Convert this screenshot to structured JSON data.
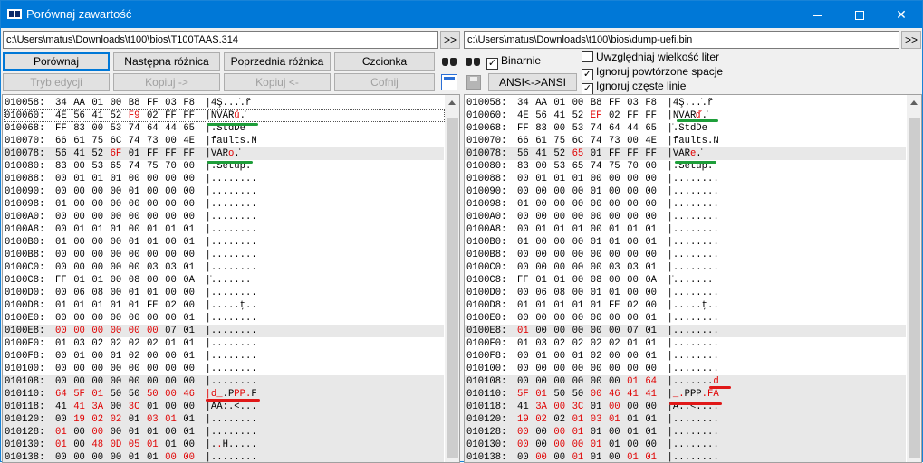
{
  "window": {
    "title": "Porównaj zawartość"
  },
  "left": {
    "path": "c:\\Users\\matus\\Downloads\\t100\\bios\\T100TAAS.314",
    "browse_label": ">>"
  },
  "right": {
    "path": "c:\\Users\\matus\\Downloads\\t100\\bios\\dump-uefi.bin",
    "browse_label": ">>"
  },
  "toolbar": {
    "compare": "Porównaj",
    "next_diff": "Następna różnica",
    "prev_diff": "Poprzednia różnica",
    "font": "Czcionka",
    "edit_mode": "Tryb edycji",
    "copy_right": "Kopiuj ->",
    "copy_left": "Kopiuj <-",
    "undo": "Cofnij",
    "ansi": "ANSI<->ANSI",
    "binary": "Binarnie",
    "case_sensitive": "Uwzględniaj wielkość liter",
    "ignore_spaces": "Ignoruj powtórzone spacje",
    "ignore_lines": "Ignoruj częste linie"
  },
  "checks": {
    "binary": true,
    "case_sensitive": false,
    "ignore_spaces": true,
    "ignore_lines": true
  },
  "colors": {
    "titlebar": "#0078d7",
    "diff": "#e00000",
    "alt_row": "#e8e8e8",
    "mark_green": "#1e9e3a",
    "mark_red": "#e01818"
  },
  "left_rows": [
    {
      "a": "010058:",
      "h": [
        "34",
        "AA",
        "01",
        "00",
        "B8",
        "FF",
        "03",
        "F8"
      ],
      "t": "|4Ş...̇.ř",
      "d": []
    },
    {
      "a": "010060:",
      "h": [
        "4E",
        "56",
        "41",
        "52",
        "F9",
        "02",
        "FF",
        "FF"
      ],
      "t": "|NVARů.̇̇",
      "d": [
        4
      ],
      "dt": [
        5
      ]
    },
    {
      "a": "010068:",
      "h": [
        "FF",
        "83",
        "00",
        "53",
        "74",
        "64",
        "44",
        "65"
      ],
      "t": "|̇.StdDe",
      "d": []
    },
    {
      "a": "010070:",
      "h": [
        "66",
        "61",
        "75",
        "6C",
        "74",
        "73",
        "00",
        "4E"
      ],
      "t": "|faults.N",
      "d": []
    },
    {
      "a": "010078:",
      "h": [
        "56",
        "41",
        "52",
        "6F",
        "01",
        "FF",
        "FF",
        "FF"
      ],
      "t": "|VARo.̇̇̇",
      "d": [
        3
      ],
      "dt": [
        4
      ]
    },
    {
      "a": "010080:",
      "h": [
        "83",
        "00",
        "53",
        "65",
        "74",
        "75",
        "70",
        "00"
      ],
      "t": "|.Setup.",
      "d": []
    },
    {
      "a": "010088:",
      "h": [
        "00",
        "01",
        "01",
        "01",
        "00",
        "00",
        "00",
        "00"
      ],
      "t": "|........",
      "d": []
    },
    {
      "a": "010090:",
      "h": [
        "00",
        "00",
        "00",
        "00",
        "01",
        "00",
        "00",
        "00"
      ],
      "t": "|........",
      "d": []
    },
    {
      "a": "010098:",
      "h": [
        "01",
        "00",
        "00",
        "00",
        "00",
        "00",
        "00",
        "00"
      ],
      "t": "|........",
      "d": []
    },
    {
      "a": "0100A0:",
      "h": [
        "00",
        "00",
        "00",
        "00",
        "00",
        "00",
        "00",
        "00"
      ],
      "t": "|........",
      "d": []
    },
    {
      "a": "0100A8:",
      "h": [
        "00",
        "01",
        "01",
        "01",
        "00",
        "01",
        "01",
        "01"
      ],
      "t": "|........",
      "d": []
    },
    {
      "a": "0100B0:",
      "h": [
        "01",
        "00",
        "00",
        "00",
        "01",
        "01",
        "00",
        "01"
      ],
      "t": "|........",
      "d": []
    },
    {
      "a": "0100B8:",
      "h": [
        "00",
        "00",
        "00",
        "00",
        "00",
        "00",
        "00",
        "00"
      ],
      "t": "|........",
      "d": []
    },
    {
      "a": "0100C0:",
      "h": [
        "00",
        "00",
        "00",
        "00",
        "00",
        "03",
        "03",
        "01"
      ],
      "t": "|........",
      "d": []
    },
    {
      "a": "0100C8:",
      "h": [
        "FF",
        "01",
        "01",
        "00",
        "08",
        "00",
        "00",
        "0A"
      ],
      "t": "|̇.......",
      "d": []
    },
    {
      "a": "0100D0:",
      "h": [
        "00",
        "06",
        "08",
        "00",
        "01",
        "01",
        "00",
        "00"
      ],
      "t": "|........",
      "d": []
    },
    {
      "a": "0100D8:",
      "h": [
        "01",
        "01",
        "01",
        "01",
        "01",
        "FE",
        "02",
        "00"
      ],
      "t": "|.....ţ..",
      "d": []
    },
    {
      "a": "0100E0:",
      "h": [
        "00",
        "00",
        "00",
        "00",
        "00",
        "00",
        "00",
        "01"
      ],
      "t": "|........",
      "d": []
    },
    {
      "a": "0100E8:",
      "h": [
        "00",
        "00",
        "00",
        "00",
        "00",
        "00",
        "07",
        "01"
      ],
      "t": "|........",
      "d": [
        0,
        1,
        2,
        3,
        4,
        5
      ]
    },
    {
      "a": "0100F0:",
      "h": [
        "01",
        "03",
        "02",
        "02",
        "02",
        "02",
        "01",
        "01"
      ],
      "t": "|........",
      "d": []
    },
    {
      "a": "0100F8:",
      "h": [
        "00",
        "01",
        "00",
        "01",
        "02",
        "00",
        "00",
        "01"
      ],
      "t": "|........",
      "d": []
    },
    {
      "a": "010100:",
      "h": [
        "00",
        "00",
        "00",
        "00",
        "00",
        "00",
        "00",
        "00"
      ],
      "t": "|........",
      "d": []
    },
    {
      "a": "010108:",
      "h": [
        "00",
        "00",
        "00",
        "00",
        "00",
        "00",
        "00",
        "00"
      ],
      "t": "|........",
      "d": []
    },
    {
      "a": "010110:",
      "h": [
        "64",
        "5F",
        "01",
        "50",
        "50",
        "50",
        "00",
        "46"
      ],
      "t": "|d_.PPP.F",
      "d": [
        0,
        1,
        2,
        5,
        6,
        7
      ],
      "dt": [
        0,
        1,
        2,
        5,
        6,
        7
      ]
    },
    {
      "a": "010118:",
      "h": [
        "41",
        "41",
        "3A",
        "00",
        "3C",
        "01",
        "00",
        "00"
      ],
      "t": "|AA:.<...",
      "d": [
        1,
        2,
        4
      ]
    },
    {
      "a": "010120:",
      "h": [
        "00",
        "19",
        "02",
        "02",
        "01",
        "03",
        "01",
        "01"
      ],
      "t": "|........",
      "d": [
        1,
        2,
        3,
        5,
        6
      ]
    },
    {
      "a": "010128:",
      "h": [
        "01",
        "00",
        "00",
        "00",
        "01",
        "01",
        "00",
        "01"
      ],
      "t": "|........",
      "d": [
        0,
        2
      ]
    },
    {
      "a": "010130:",
      "h": [
        "01",
        "00",
        "48",
        "0D",
        "05",
        "01",
        "01",
        "00"
      ],
      "t": "|..H.....",
      "d": [
        0,
        2,
        3,
        4,
        5
      ],
      "dt": [
        2
      ]
    },
    {
      "a": "010138:",
      "h": [
        "00",
        "00",
        "00",
        "00",
        "01",
        "01",
        "00",
        "00"
      ],
      "t": "|........",
      "d": [
        6,
        7
      ]
    }
  ],
  "right_rows": [
    {
      "a": "010058:",
      "h": [
        "34",
        "AA",
        "01",
        "00",
        "B8",
        "FF",
        "03",
        "F8"
      ],
      "t": "|4Ş...̇.ř",
      "d": []
    },
    {
      "a": "010060:",
      "h": [
        "4E",
        "56",
        "41",
        "52",
        "EF",
        "02",
        "FF",
        "FF"
      ],
      "t": "|NVARď.̇̇",
      "d": [
        4
      ],
      "dt": [
        5
      ]
    },
    {
      "a": "010068:",
      "h": [
        "FF",
        "83",
        "00",
        "53",
        "74",
        "64",
        "44",
        "65"
      ],
      "t": "|̇.StdDe",
      "d": []
    },
    {
      "a": "010070:",
      "h": [
        "66",
        "61",
        "75",
        "6C",
        "74",
        "73",
        "00",
        "4E"
      ],
      "t": "|faults.N",
      "d": []
    },
    {
      "a": "010078:",
      "h": [
        "56",
        "41",
        "52",
        "65",
        "01",
        "FF",
        "FF",
        "FF"
      ],
      "t": "|VARe.̇̇̇",
      "d": [
        3
      ],
      "dt": [
        4
      ]
    },
    {
      "a": "010080:",
      "h": [
        "83",
        "00",
        "53",
        "65",
        "74",
        "75",
        "70",
        "00"
      ],
      "t": "|.Setup.",
      "d": []
    },
    {
      "a": "010088:",
      "h": [
        "00",
        "01",
        "01",
        "01",
        "00",
        "00",
        "00",
        "00"
      ],
      "t": "|........",
      "d": []
    },
    {
      "a": "010090:",
      "h": [
        "00",
        "00",
        "00",
        "00",
        "01",
        "00",
        "00",
        "00"
      ],
      "t": "|........",
      "d": []
    },
    {
      "a": "010098:",
      "h": [
        "01",
        "00",
        "00",
        "00",
        "00",
        "00",
        "00",
        "00"
      ],
      "t": "|........",
      "d": []
    },
    {
      "a": "0100A0:",
      "h": [
        "00",
        "00",
        "00",
        "00",
        "00",
        "00",
        "00",
        "00"
      ],
      "t": "|........",
      "d": []
    },
    {
      "a": "0100A8:",
      "h": [
        "00",
        "01",
        "01",
        "01",
        "00",
        "01",
        "01",
        "01"
      ],
      "t": "|........",
      "d": []
    },
    {
      "a": "0100B0:",
      "h": [
        "01",
        "00",
        "00",
        "00",
        "01",
        "01",
        "00",
        "01"
      ],
      "t": "|........",
      "d": []
    },
    {
      "a": "0100B8:",
      "h": [
        "00",
        "00",
        "00",
        "00",
        "00",
        "00",
        "00",
        "00"
      ],
      "t": "|........",
      "d": []
    },
    {
      "a": "0100C0:",
      "h": [
        "00",
        "00",
        "00",
        "00",
        "00",
        "03",
        "03",
        "01"
      ],
      "t": "|........",
      "d": []
    },
    {
      "a": "0100C8:",
      "h": [
        "FF",
        "01",
        "01",
        "00",
        "08",
        "00",
        "00",
        "0A"
      ],
      "t": "|̇.......",
      "d": []
    },
    {
      "a": "0100D0:",
      "h": [
        "00",
        "06",
        "08",
        "00",
        "01",
        "01",
        "00",
        "00"
      ],
      "t": "|........",
      "d": []
    },
    {
      "a": "0100D8:",
      "h": [
        "01",
        "01",
        "01",
        "01",
        "01",
        "FE",
        "02",
        "00"
      ],
      "t": "|.....ţ..",
      "d": []
    },
    {
      "a": "0100E0:",
      "h": [
        "00",
        "00",
        "00",
        "00",
        "00",
        "00",
        "00",
        "01"
      ],
      "t": "|........",
      "d": []
    },
    {
      "a": "0100E8:",
      "h": [
        "01",
        "00",
        "00",
        "00",
        "00",
        "00",
        "07",
        "01"
      ],
      "t": "|........",
      "d": [
        0
      ]
    },
    {
      "a": "0100F0:",
      "h": [
        "01",
        "03",
        "02",
        "02",
        "02",
        "02",
        "01",
        "01"
      ],
      "t": "|........",
      "d": []
    },
    {
      "a": "0100F8:",
      "h": [
        "00",
        "01",
        "00",
        "01",
        "02",
        "00",
        "00",
        "01"
      ],
      "t": "|........",
      "d": []
    },
    {
      "a": "010100:",
      "h": [
        "00",
        "00",
        "00",
        "00",
        "00",
        "00",
        "00",
        "00"
      ],
      "t": "|........",
      "d": []
    },
    {
      "a": "010108:",
      "h": [
        "00",
        "00",
        "00",
        "00",
        "00",
        "00",
        "01",
        "64"
      ],
      "t": "|.......d",
      "d": [
        6,
        7
      ],
      "dt": [
        8
      ]
    },
    {
      "a": "010110:",
      "h": [
        "5F",
        "01",
        "50",
        "50",
        "00",
        "46",
        "41",
        "41"
      ],
      "t": "|_.PPP.FA",
      "d": [
        0,
        1,
        4,
        5,
        6,
        7
      ],
      "dt": [
        1,
        2,
        6,
        7,
        8
      ]
    },
    {
      "a": "010118:",
      "h": [
        "41",
        "3A",
        "00",
        "3C",
        "01",
        "00",
        "00",
        "00"
      ],
      "t": "|A:.<....",
      "d": [
        1,
        2,
        3,
        5
      ]
    },
    {
      "a": "010120:",
      "h": [
        "19",
        "02",
        "02",
        "01",
        "03",
        "01",
        "01",
        "01"
      ],
      "t": "|........",
      "d": [
        0,
        1,
        3,
        4,
        5
      ]
    },
    {
      "a": "010128:",
      "h": [
        "00",
        "00",
        "00",
        "01",
        "01",
        "00",
        "01",
        "01"
      ],
      "t": "|........",
      "d": [
        0,
        2,
        3
      ]
    },
    {
      "a": "010130:",
      "h": [
        "00",
        "00",
        "00",
        "00",
        "01",
        "01",
        "00",
        "00"
      ],
      "t": "|........",
      "d": [
        0,
        2,
        3,
        4
      ]
    },
    {
      "a": "010138:",
      "h": [
        "00",
        "00",
        "00",
        "01",
        "01",
        "00",
        "01",
        "01"
      ],
      "t": "|........",
      "d": [
        1,
        3,
        6,
        7
      ]
    }
  ]
}
